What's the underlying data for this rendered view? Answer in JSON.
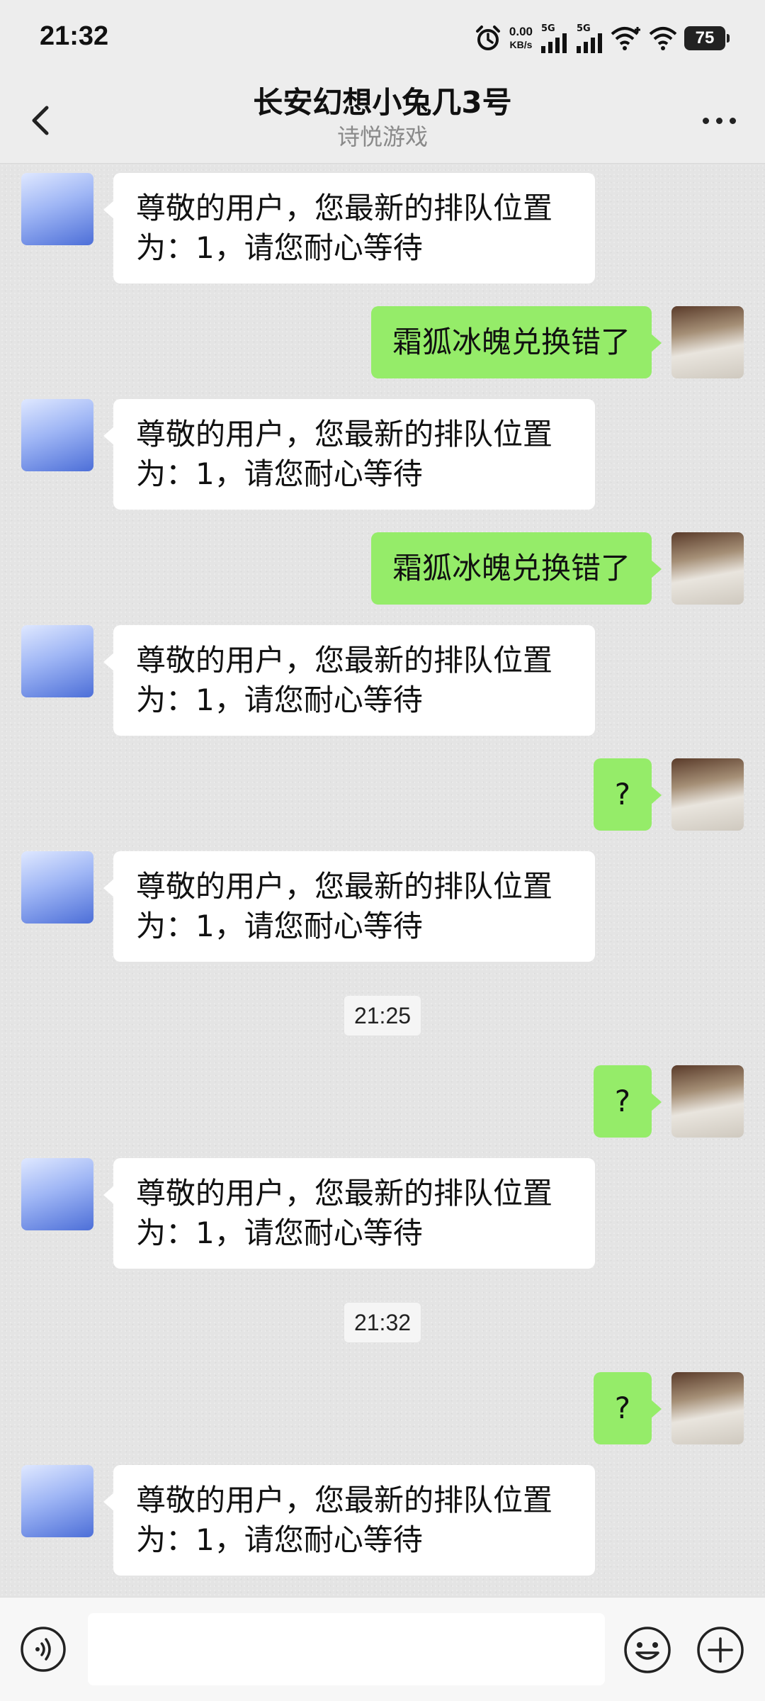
{
  "status_bar": {
    "time": "21:32",
    "net_speed": "0.00",
    "net_unit": "KB/s",
    "signal1_tag": "5G",
    "signal2_tag": "5G",
    "battery": "75"
  },
  "header": {
    "title": "长安幻想小兔几3号",
    "subtitle": "诗悦游戏"
  },
  "messages": [
    {
      "side": "left",
      "text": "尊敬的用户，您最新的排队位置为：1，请您耐心等待"
    },
    {
      "side": "right",
      "text": "霜狐冰魄兑换错了"
    },
    {
      "side": "left",
      "text": "尊敬的用户，您最新的排队位置为：1，请您耐心等待"
    },
    {
      "side": "right",
      "text": "霜狐冰魄兑换错了"
    },
    {
      "side": "left",
      "text": "尊敬的用户，您最新的排队位置为：1，请您耐心等待"
    },
    {
      "side": "right",
      "text": "?"
    },
    {
      "side": "left",
      "text": "尊敬的用户，您最新的排队位置为：1，请您耐心等待"
    },
    {
      "side": "time",
      "text": "21:25"
    },
    {
      "side": "right",
      "text": "?"
    },
    {
      "side": "left",
      "text": "尊敬的用户，您最新的排队位置为：1，请您耐心等待"
    },
    {
      "side": "time",
      "text": "21:32"
    },
    {
      "side": "right",
      "text": "?"
    },
    {
      "side": "left",
      "text": "尊敬的用户，您最新的排队位置为：1，请您耐心等待"
    }
  ],
  "input": {
    "value": "",
    "placeholder": ""
  },
  "colors": {
    "sent_bubble": "#95ec69",
    "received_bubble": "#ffffff",
    "chat_background": "#e4e4e4"
  },
  "icons": {
    "back": "chevron-left-icon",
    "more": "more-dots-icon",
    "voice": "voice-icon",
    "emoji": "emoji-icon",
    "plus": "plus-icon"
  }
}
